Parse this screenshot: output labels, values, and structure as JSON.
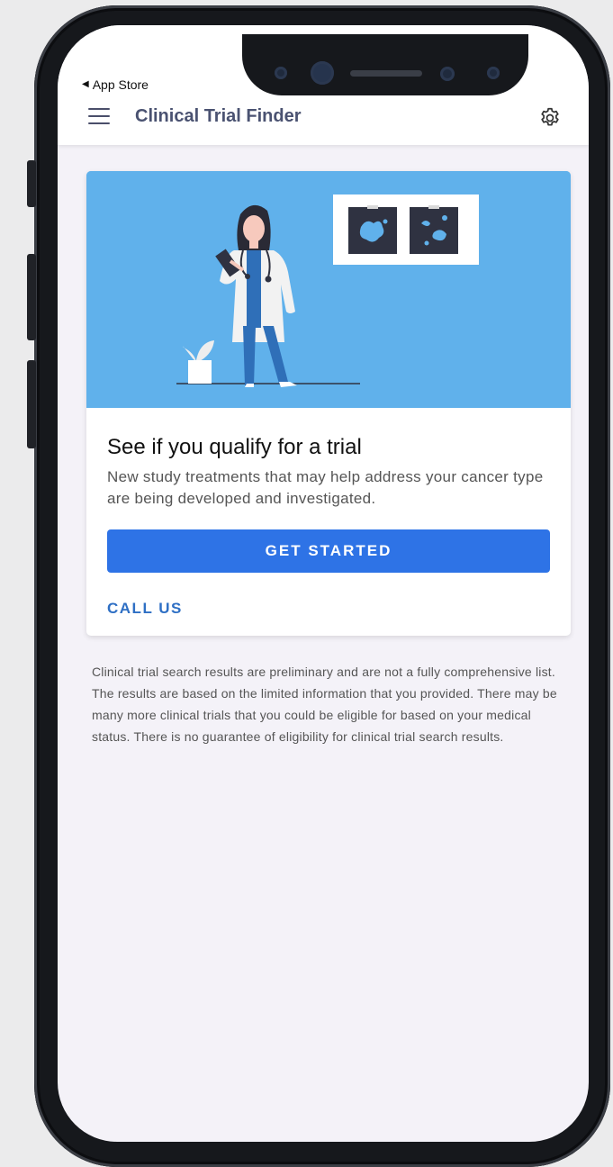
{
  "status_bar": {
    "back_label": "App Store"
  },
  "app_bar": {
    "title": "Clinical Trial Finder"
  },
  "card": {
    "title": "See if you qualify for a trial",
    "description": "New study treatments that may help address your cancer type are being developed and investigated.",
    "primary_button": "GET STARTED",
    "secondary_button": "CALL US"
  },
  "disclaimer": "Clinical trial search results are preliminary and are not a fully comprehensive list. The results are based on the limited information that you provided. There may be many more clinical trials that you could be eligible for based on your medical status. There is no guarantee of eligibility for clinical trial search results.",
  "colors": {
    "accent": "#2e73e6",
    "hero_bg": "#60b1eb",
    "title_text": "#4a5271",
    "screen_bg": "#f4f2f8"
  },
  "icons": {
    "menu": "menu-icon",
    "settings": "gear-icon",
    "back": "back-triangle-icon"
  }
}
